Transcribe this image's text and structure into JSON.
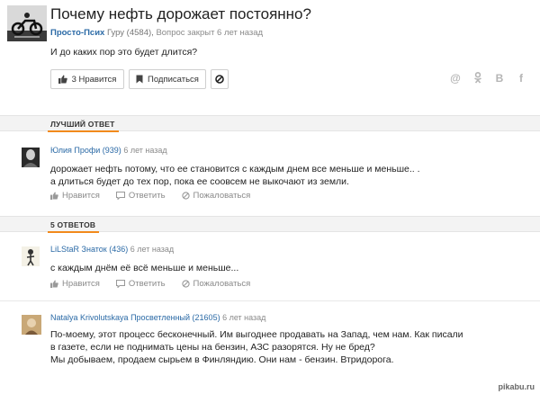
{
  "question": {
    "title": "Почему нефть дорожает постоянно?",
    "author": "Просто-Псих",
    "author_rank": "Гуру (4584),",
    "status": "Вопрос закрыт 6 лет назад",
    "body": "И до каких пор это будет длится?",
    "like_label": "3 Нравится",
    "subscribe_label": "Подписаться",
    "share_icons": [
      "@",
      "ok",
      "B",
      "f"
    ]
  },
  "best_answer": {
    "section_label": "ЛУЧШИЙ ОТВЕТ",
    "author": "Юлия",
    "rank": "Профи (939)",
    "time": "6 лет назад",
    "text": [
      "дорожает нефть потому, что ее становится с каждым днем все меньше и меньше.. .",
      "а длиться будет до тех пор, пока ее соовсем не выкочают из земли."
    ],
    "like": "Нравится",
    "comment": "Ответить",
    "report": "Пожаловаться"
  },
  "answers_section": {
    "label": "5 ОТВЕТОВ"
  },
  "answers": [
    {
      "author": "LiLStaR",
      "rank": "Знаток (436)",
      "time": "6 лет назад",
      "text": [
        "с каждым днём её всё меньше и меньше..."
      ],
      "like": "Нравится",
      "comment": "Ответить",
      "report": "Пожаловаться"
    },
    {
      "author": "Natalya Krivolutskaya",
      "rank": "Просветленный (21605)",
      "time": "6 лет назад",
      "text": [
        "По-моему, этот процесс бесконечный. Им выгоднее продавать на Запад, чем нам. Как писали",
        "в газете, если не поднимать цены на бензин, АЗС разорятся. Ну не бред?",
        "Мы добываем, продаем сырьем в Финляндию. Они нам - бензин. Втридорога."
      ]
    }
  ],
  "watermark": "pikabu.ru",
  "colors": {
    "accent": "#f28a1c",
    "link": "#2b6aa6",
    "muted": "#8a8a8a"
  }
}
